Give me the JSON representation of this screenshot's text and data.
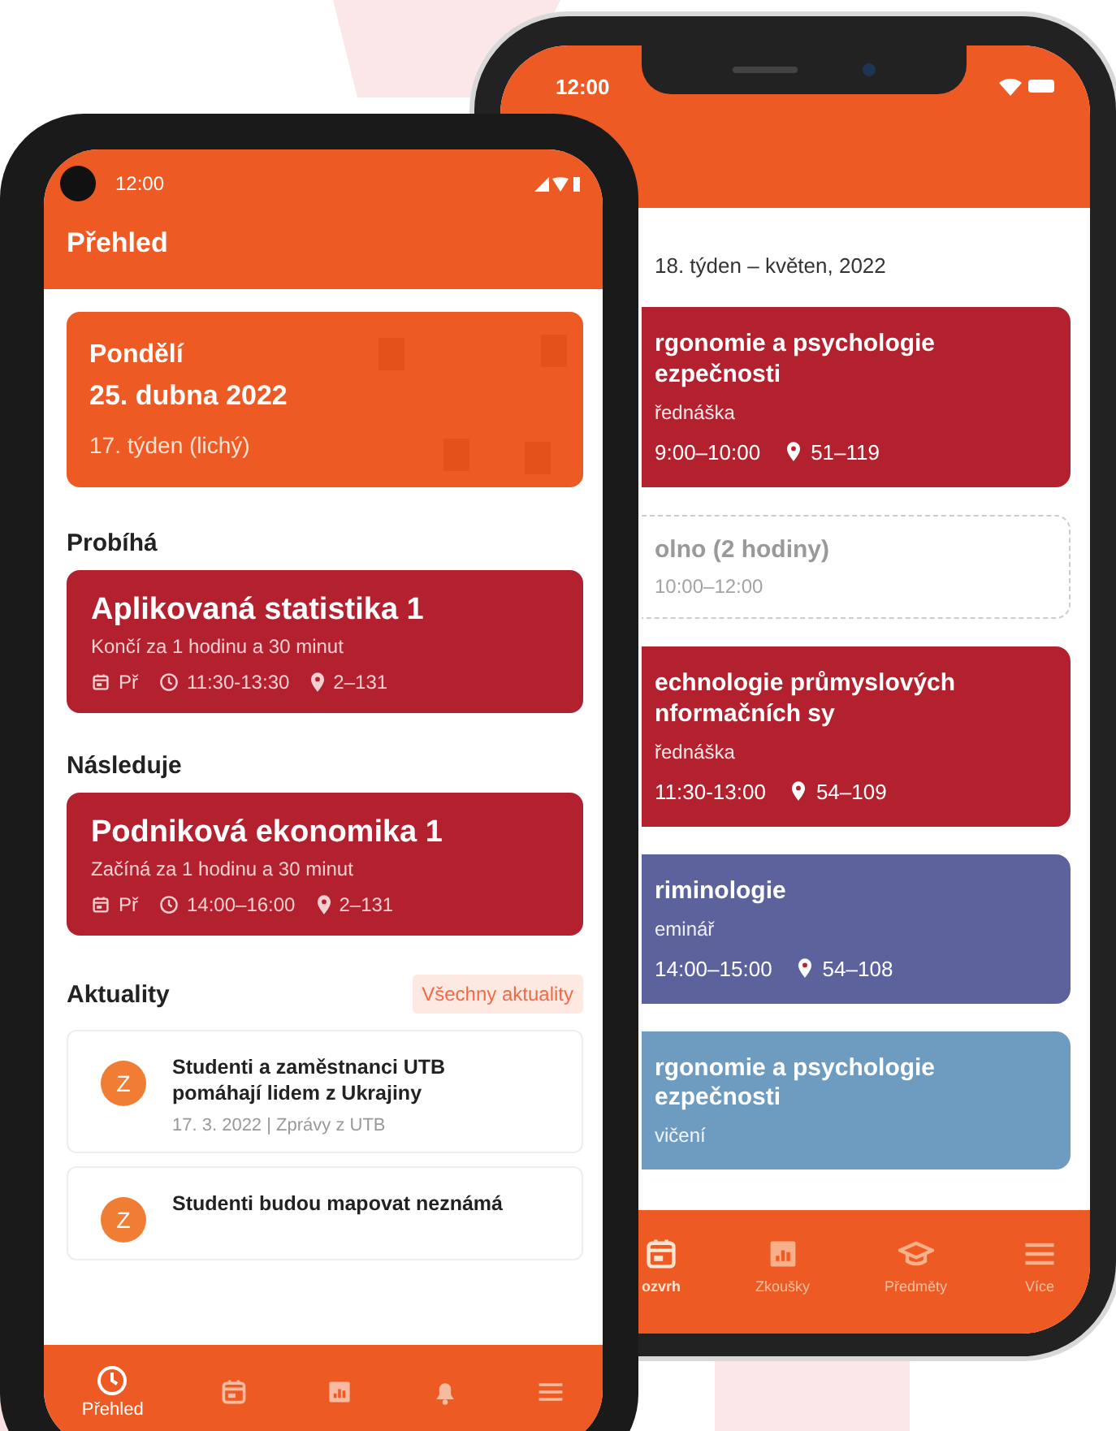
{
  "front_phone": {
    "status_time": "12:00",
    "title": "Přehled",
    "day_card": {
      "weekday": "Pondělí",
      "date": "25. dubna 2022",
      "week": "17. týden (lichý)"
    },
    "sections": [
      {
        "heading": "Probíhá",
        "course": {
          "name": "Aplikovaná statistika 1",
          "remaining": "Končí za 1 hodinu a 30 minut",
          "day": "Př",
          "time": "11:30-13:30",
          "room": "2–131"
        }
      },
      {
        "heading": "Následuje",
        "course": {
          "name": "Podniková ekonomika 1",
          "remaining": "Začíná za 1 hodinu a 30 minut",
          "day": "Př",
          "time": "14:00–16:00",
          "room": "2–131"
        }
      }
    ],
    "news": {
      "heading": "Aktuality",
      "all_button": "Všechny aktuality",
      "items": [
        {
          "avatar": "Z",
          "title": "Studenti a zaměstnanci UTB pomáhají lidem z Ukrajiny",
          "meta": "17. 3. 2022 | Zprávy z UTB"
        },
        {
          "avatar": "Z",
          "title": "Studenti budou mapovat neznámá"
        }
      ]
    },
    "nav": [
      {
        "label": "Přehled",
        "selected": true
      },
      {
        "selected": false
      },
      {
        "selected": false
      },
      {
        "selected": false
      },
      {
        "selected": false
      }
    ]
  },
  "back_phone": {
    "status_time": "12:00",
    "week": "18. týden – květen, 2022",
    "events": [
      {
        "kind": "lesson",
        "color": "#b3202e",
        "title_lines": [
          "rgonomie a psychologie",
          "ezpečnosti"
        ],
        "type": "řednáška",
        "time": "9:00–10:00",
        "room": "51–119"
      },
      {
        "kind": "free",
        "title_lines": [
          "olno (2 hodiny)"
        ],
        "time": "10:00–12:00"
      },
      {
        "kind": "lesson",
        "color": "#b3202e",
        "title_lines": [
          "echnologie průmyslových",
          "nformačních sy"
        ],
        "type": "řednáška",
        "time": "11:30-13:00",
        "room": "54–109"
      },
      {
        "kind": "lesson",
        "color": "#5b629c",
        "title_lines": [
          "riminologie"
        ],
        "type": "eminář",
        "time": "14:00–15:00",
        "room": "54–108"
      },
      {
        "kind": "lesson",
        "color": "#6e9bc0",
        "title_lines": [
          "rgonomie a psychologie",
          "ezpečnosti"
        ],
        "type": "vičení"
      }
    ],
    "nav": [
      {
        "label": "ozvrh",
        "selected": true
      },
      {
        "label": "Zkoušky",
        "selected": false
      },
      {
        "label": "Předměty",
        "selected": false
      },
      {
        "label": "Více",
        "selected": false
      }
    ]
  }
}
